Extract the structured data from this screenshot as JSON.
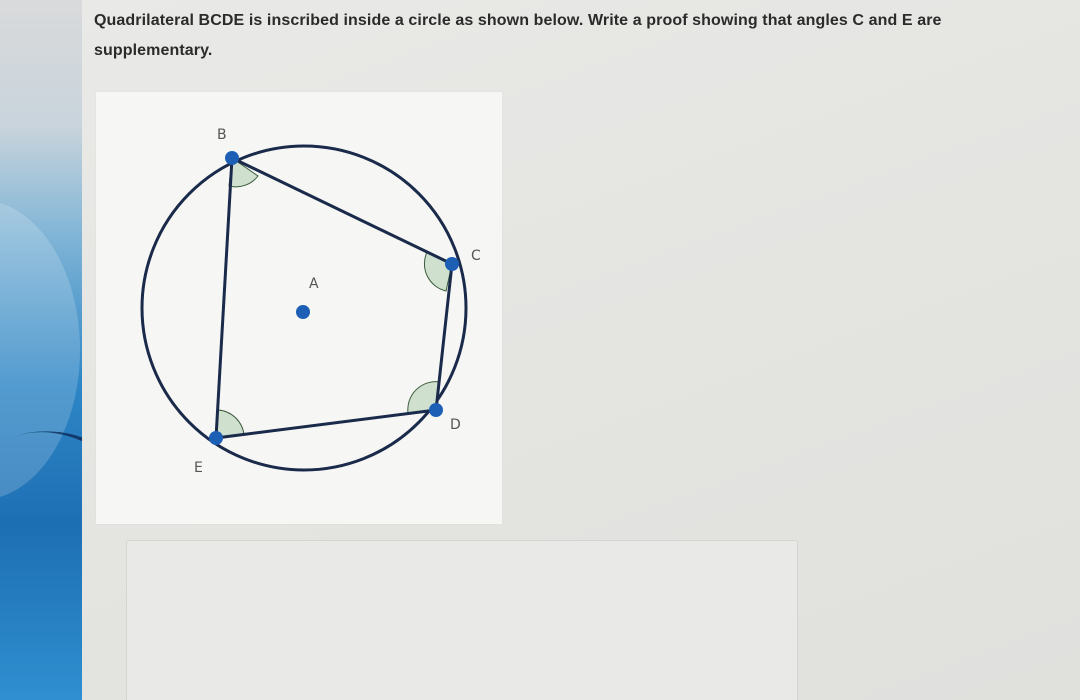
{
  "question": {
    "text": "Quadrilateral BCDE is inscribed inside a circle as shown below. Write a proof showing that angles C and E are supplementary."
  },
  "figure": {
    "center_label": "A",
    "points": [
      "B",
      "C",
      "D",
      "E"
    ],
    "colors": {
      "circle": "#1a2a4a",
      "vertex": "#1d5fb5",
      "angle_fill": "#cfe0cf"
    }
  },
  "answer": {
    "value": ""
  }
}
